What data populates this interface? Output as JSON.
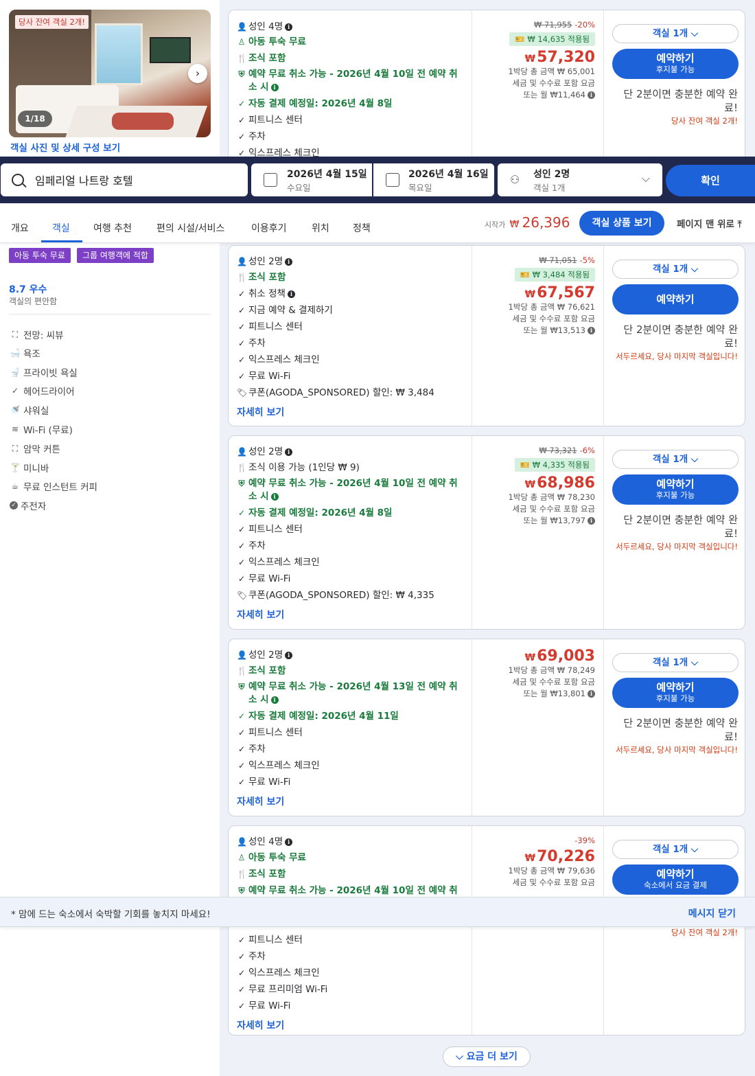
{
  "colors": {
    "accent": "#1d62d8",
    "price": "#d23b2e",
    "green": "#1a7a3c",
    "searchbar_bg": "#20294d"
  },
  "photo": {
    "badge": "당사 잔여 객실 2개!",
    "counter": "1/18",
    "link": "객실 사진 및 상세 구성 보기"
  },
  "search": {
    "destination": "임페리얼 나트랑 호텔",
    "checkin_date": "2026년 4월 15일",
    "checkin_day": "수요일",
    "checkout_date": "2026년 4월 16일",
    "checkout_day": "목요일",
    "guests": "성인 2명",
    "rooms": "객실 1개",
    "confirm": "확인"
  },
  "nav": {
    "tabs": [
      "개요",
      "객실",
      "여행 추천",
      "편의 시설/서비스",
      "이용후기",
      "위치",
      "정책"
    ],
    "from_label": "시작가",
    "currency": "₩",
    "from_price": "26,396",
    "view_rooms": "객실 상품 보기",
    "to_top": "페이지 맨 위로"
  },
  "sidebar": {
    "tags": [
      "아동 투숙 무료",
      "그룹 여행객에 적합"
    ],
    "score": "8.7 우수",
    "score_sub": "객실의 편안함",
    "amenities": [
      "전망: 씨뷰",
      "욕조",
      "프라이빗 욕실",
      "헤어드라이어",
      "샤워실",
      "Wi-Fi (무료)",
      "암막 커튼",
      "미니바",
      "무료 인스턴트 커피",
      "주전자"
    ]
  },
  "offers": [
    {
      "guests": "성인 4명",
      "features": [
        "아동 투숙 무료",
        "조식 포함",
        "예약 무료 취소 가능 - 2026년 4월 10일 전 예약 취소 시",
        "자동 결제 예정일: 2026년 4월 8일",
        "피트니스 센터",
        "주차",
        "익스프레스 체크인"
      ],
      "original": "₩ 71,955",
      "discount": "-20%",
      "applied": "₩ 14,635 적용됨",
      "price": "57,320",
      "total": "1박당 총 금액 ₩ 65,001",
      "tax": "세금 및 수수료 포함 요금",
      "monthly": "또는 월 ₩11,464",
      "qty": "객실 1개",
      "book": "예약하기",
      "book_sub": "후지불 가능",
      "urgency": "단 2분이면 충분한 예약 완료!",
      "warning": "당사 잔여 객실 2개!"
    },
    {
      "guests": "성인 2명",
      "features": [
        "조식 포함",
        "취소 정책",
        "지금 예약 & 결제하기",
        "피트니스 센터",
        "주차",
        "익스프레스 체크인",
        "무료 Wi-Fi",
        "쿠폰(AGODA_SPONSORED) 할인: ₩ 3,484"
      ],
      "more": "자세히 보기",
      "original": "₩ 71,051",
      "discount": "-5%",
      "applied": "₩ 3,484 적용됨",
      "price": "67,567",
      "total": "1박당 총 금액 ₩ 76,621",
      "tax": "세금 및 수수료 포함 요금",
      "monthly": "또는 월 ₩13,513",
      "qty": "객실 1개",
      "book": "예약하기",
      "urgency": "단 2분이면 충분한 예약 완료!",
      "warning": "서두르세요, 당사 마지막 객실입니다!"
    },
    {
      "guests": "성인 2명",
      "features": [
        "조식 이용 가능 (1인당 ₩ 9)",
        "예약 무료 취소 가능 - 2026년 4월 10일 전 예약 취소 시",
        "자동 결제 예정일: 2026년 4월 8일",
        "피트니스 센터",
        "주차",
        "익스프레스 체크인",
        "무료 Wi-Fi",
        "쿠폰(AGODA_SPONSORED) 할인: ₩ 4,335"
      ],
      "more": "자세히 보기",
      "original": "₩ 73,321",
      "discount": "-6%",
      "applied": "₩ 4,335 적용됨",
      "price": "68,986",
      "total": "1박당 총 금액 ₩ 78,230",
      "tax": "세금 및 수수료 포함 요금",
      "monthly": "또는 월 ₩13,797",
      "qty": "객실 1개",
      "book": "예약하기",
      "book_sub": "후지불 가능",
      "urgency": "단 2분이면 충분한 예약 완료!",
      "warning": "서두르세요, 당사 마지막 객실입니다!"
    },
    {
      "guests": "성인 2명",
      "features": [
        "조식 포함",
        "예약 무료 취소 가능 - 2026년 4월 13일 전 예약 취소 시",
        "자동 결제 예정일: 2026년 4월 11일",
        "피트니스 센터",
        "주차",
        "익스프레스 체크인",
        "무료 Wi-Fi"
      ],
      "more": "자세히 보기",
      "price": "69,003",
      "total": "1박당 총 금액 ₩ 78,249",
      "tax": "세금 및 수수료 포함 요금",
      "monthly": "또는 월 ₩13,801",
      "qty": "객실 1개",
      "book": "예약하기",
      "book_sub": "후지불 가능",
      "urgency": "단 2분이면 충분한 예약 완료!",
      "warning": "서두르세요, 당사 마지막 객실입니다!"
    },
    {
      "guests": "성인 4명",
      "features": [
        "아동 투숙 무료",
        "조식 포함",
        "예약 무료 취소 가능 - 2026년 4월 10일 전 예약 취",
        "피트니스 센터",
        "주차",
        "익스프레스 체크인",
        "무료 프리미엄 Wi-Fi",
        "무료 Wi-Fi"
      ],
      "more": "자세히 보기",
      "discount": "-39%",
      "price": "70,226",
      "total": "1박당 총 금액 ₩ 79,636",
      "tax": "세금 및 수수료 포함 요금",
      "qty": "객실 1개",
      "book": "예약하기",
      "book_sub": "숙소에서 요금 결제",
      "warning": "당사 잔여 객실 2개!"
    }
  ],
  "banner": {
    "text": "* 맘에 드는 숙소에서 숙박할 기회를 놓치지 마세요!",
    "close": "메시지 닫기"
  },
  "more_rates": "요금 더 보기"
}
